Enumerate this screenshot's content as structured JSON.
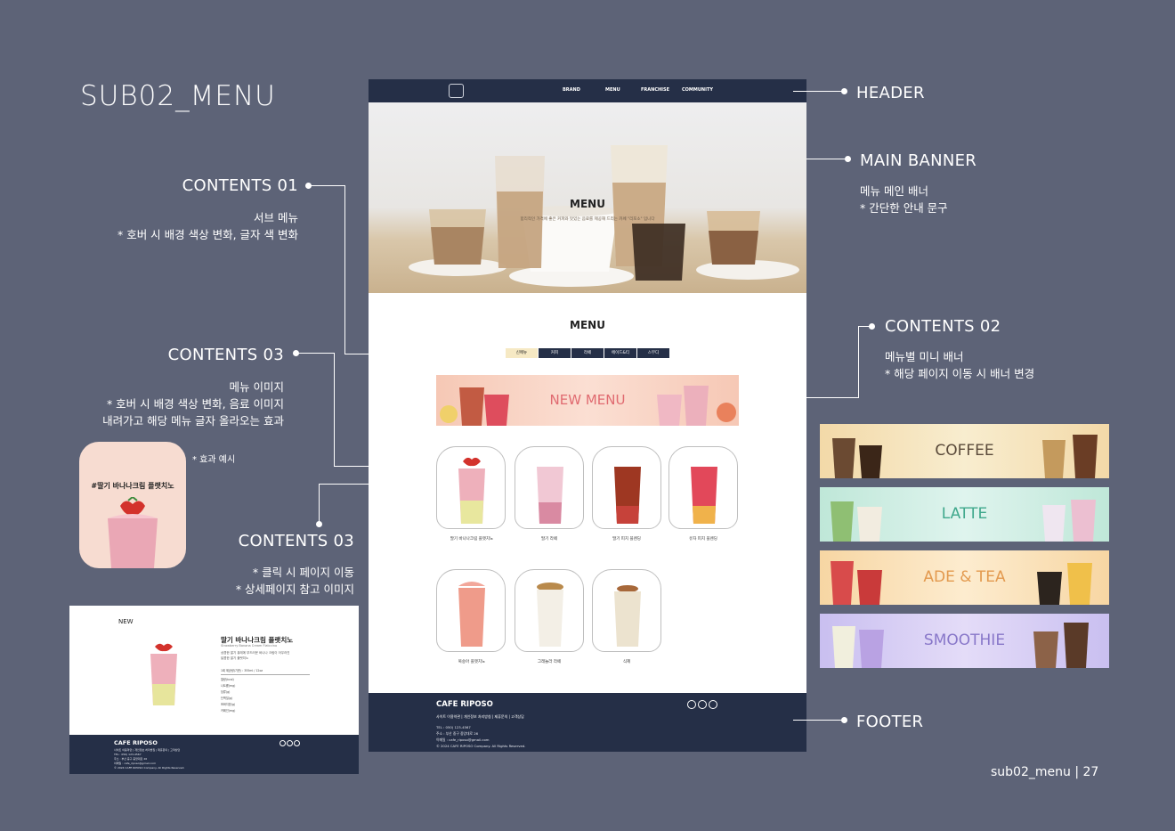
{
  "page_title": "SUB02_MENU",
  "annotations": {
    "contents01": {
      "title": "CONTENTS 01",
      "desc1": "서브 메뉴",
      "desc2": "* 호버 시 배경 색상 변화, 글자 색 변화"
    },
    "contents03a": {
      "title": "CONTENTS 03",
      "desc1": "메뉴  이미지",
      "desc2": "* 호버 시 배경 색상 변화, 음료 이미지",
      "desc3": "내려가고 해당 메뉴 글자 올라오는 효과"
    },
    "effect_example": "* 효과 예시",
    "contents03b": {
      "title": "CONTENTS 03",
      "desc1": "* 클릭 시 페이지 이동",
      "desc2": "* 상세페이지 참고 이미지"
    },
    "header": {
      "title": "HEADER"
    },
    "main_banner": {
      "title": "MAIN BANNER",
      "desc1": "메뉴 메인 배너",
      "desc2": "* 간단한 안내  문구"
    },
    "contents02": {
      "title": "CONTENTS 02",
      "desc1": "메뉴별 미니 배너",
      "desc2": "* 해당 페이지 이동 시 배너 변경"
    },
    "footer": {
      "title": "FOOTER"
    }
  },
  "mockup": {
    "nav": [
      "BRAND",
      "MENU",
      "FRANCHISE",
      "COMMUNITY"
    ],
    "banner_title": "MENU",
    "banner_sub": "합리적인 가격에 좋은 커피와 맛있는 음료를 제공해 드리는 카페 \"리포소\" 입니다",
    "menu_heading": "MENU",
    "tabs": [
      "신메뉴",
      "커피",
      "라떼",
      "에이드&티",
      "스무디"
    ],
    "mini_banner": "NEW MENU",
    "products": [
      "딸기 바나나크림 플랫치노",
      "딸기 라떼",
      "딸기 피치 블렌딩",
      "유자 피치 블렌딩",
      "복숭아 플랫치노",
      "그래놀라 라떼",
      "식혜"
    ],
    "footer": {
      "brand": "CAFE RIPOSO",
      "links": "사이트 이용약관  |  개인정보 처리방침  |  제휴문의  |  고객상담",
      "tel": "TEL : 050) 123-4567",
      "addr": "주소 : 부산 중구 중앙대로 26",
      "email": "이메일 : cafe_riposo@gmail.com",
      "copyright": "© 2024 CAFE RIPOSO Company. All Rights Reserved."
    }
  },
  "side_banners": [
    {
      "label": "COFFEE",
      "bg": "#f6e7c5",
      "color": "#5a4a3a"
    },
    {
      "label": "LATTE",
      "bg": "#cfeee4",
      "color": "#3fa88c"
    },
    {
      "label": "ADE & TEA",
      "bg": "#fbe2b7",
      "color": "#e39a4f"
    },
    {
      "label": "SMOOTHIE",
      "bg": "#d6cdf3",
      "color": "#8877c9"
    }
  ],
  "effect_card_text": "#딸기 바나나크림 플랫치노",
  "detail": {
    "new": "NEW",
    "name": "딸기 바나나크림 플랫치노",
    "eng": "Strawberry Banana Cream Flatccino",
    "desc1": "상큼한 딸기 퓨레에 부드러운 바나나 크림이 어우러진",
    "desc2": "달콤한 딸기 플랫치노",
    "table_head": "1회 제공량(기준) : 355ml / 12oz",
    "rows": [
      "열량(kcal)",
      "나트륨(mg)",
      "당류(g)",
      "단백질(g)",
      "포화지방(g)",
      "카페인(mg)"
    ],
    "footer_brand": "CAFE RIPOSO",
    "footer_links": "사이트 이용약관  |  개인정보 처리방침  |  제휴문의  |  고객상담",
    "footer_tel": "TEL : 050) 123-4567",
    "footer_addr": "주소 : 부산 중구 중앙대로 26",
    "footer_email": "이메일 : cafe_riposo@gmail.com",
    "footer_copy": "© 2024 CAFE RIPOSO Company. All Rights Reserved."
  },
  "page_number": "sub02_menu | 27"
}
